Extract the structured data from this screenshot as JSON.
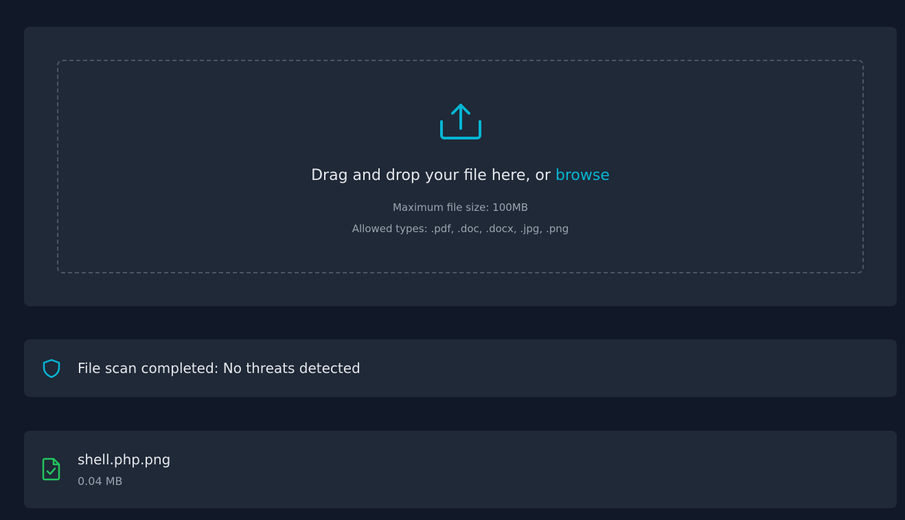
{
  "upload": {
    "drop_text": "Drag and drop your file here, or",
    "browse_label": "browse",
    "max_size": "Maximum file size: 100MB",
    "allowed_types": "Allowed types: .pdf, .doc, .docx, .jpg, .png",
    "icon": "upload-icon"
  },
  "status": {
    "message": "File scan completed: No threats detected",
    "icon": "shield-icon"
  },
  "file": {
    "name": "shell.php.png",
    "size": "0.04 MB",
    "icon": "file-check-icon"
  },
  "colors": {
    "background": "#111827",
    "card": "#1f2937",
    "accent": "#06b6d4",
    "success": "#22c55e",
    "text": "#e5e7eb",
    "muted": "#9ca3af"
  }
}
